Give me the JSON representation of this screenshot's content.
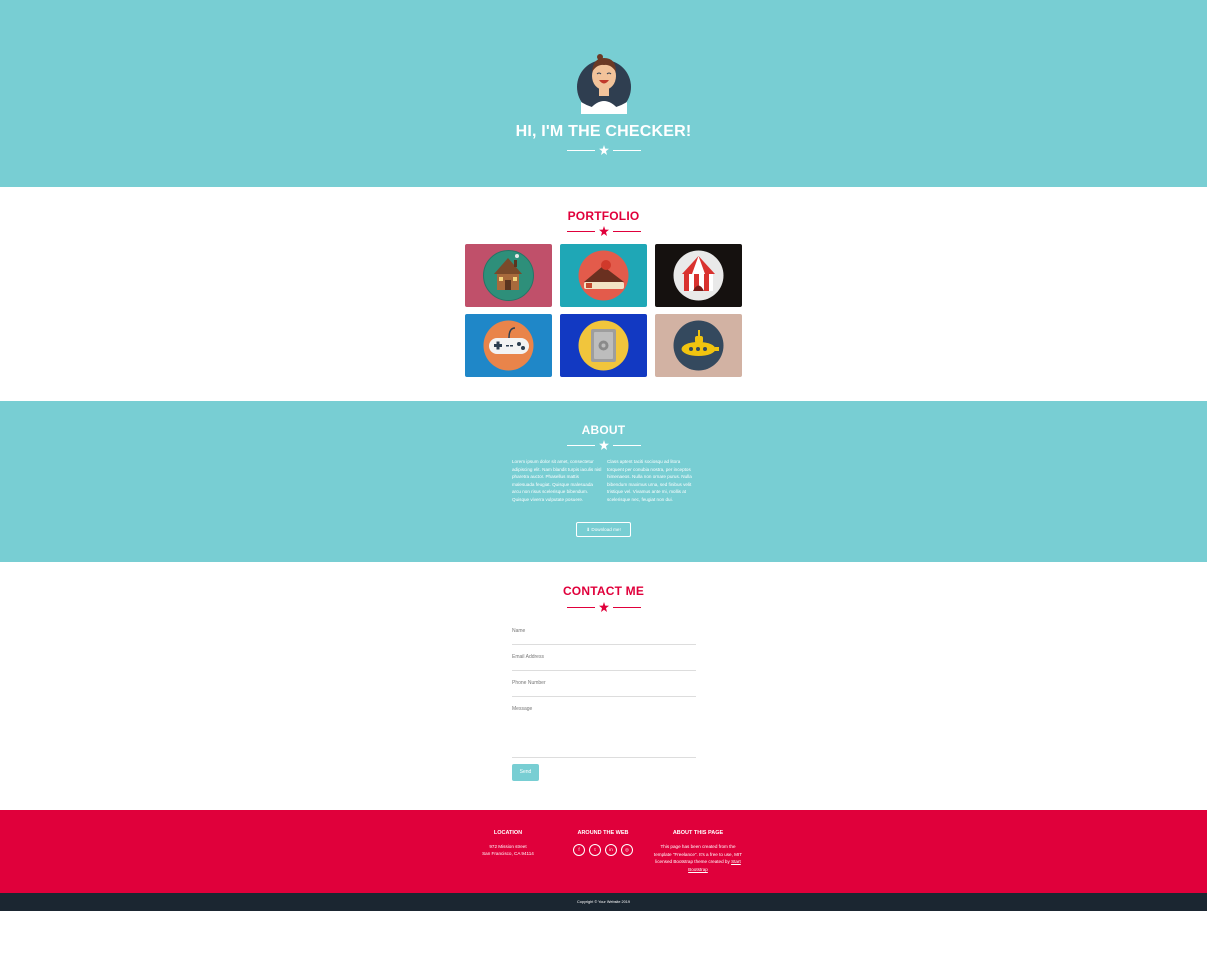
{
  "colors": {
    "teal": "#78ced3",
    "red": "#e0003b",
    "dark": "#1b2631",
    "white": "#ffffff"
  },
  "masthead": {
    "title": "HI, I'M THE CHECKER!",
    "avatar_icon": "avatar-icon"
  },
  "portfolio": {
    "title": "PORTFOLIO",
    "items": [
      {
        "icon": "cabin-icon",
        "bg": "#c0506a"
      },
      {
        "icon": "cake-icon",
        "bg": "#1fa7b6"
      },
      {
        "icon": "circus-tent-icon",
        "bg": "#15110f"
      },
      {
        "icon": "game-controller-icon",
        "bg": "#1f87c8"
      },
      {
        "icon": "safe-icon",
        "bg": "#1239c2"
      },
      {
        "icon": "submarine-icon",
        "bg": "#d2b2a3"
      }
    ]
  },
  "about": {
    "title": "ABOUT",
    "col1": "Lorem ipsum dolor sit amet, consectetur adipiscing elit. Nam blandit turpis iaculis nisl pharetra auctor. Phasellus mattis malesuada feugiat. Quisque malesuada arcu non risus scelerisque bibendum. Quisque viverra vulputate posuere.",
    "col2": "Class aptent taciti sociosqu ad litora torquent per conubia nostra, per inceptos himenaeos. Nulla non ornare purus. Nulla bibendum maximus urna, sed finibus velit tristique vel. Vivamus ante mi, mollis at scelerisque nec, feugiat non dui.",
    "download_label": "Download me!",
    "download_icon": "download-icon"
  },
  "contact": {
    "title": "CONTACT ME",
    "fields": {
      "name": "Name",
      "email": "Email Address",
      "phone": "Phone Number",
      "message": "Message"
    },
    "send_label": "Send"
  },
  "footer": {
    "location": {
      "heading": "LOCATION",
      "line1": "972 Mission street",
      "line2": "San Francisco, CA 94114"
    },
    "web": {
      "heading": "AROUND THE WEB",
      "icons": [
        "facebook-icon",
        "twitter-icon",
        "linkedin-icon",
        "dribbble-icon"
      ],
      "glyphs": [
        "f",
        "t",
        "in",
        "◎"
      ]
    },
    "about_page": {
      "heading": "ABOUT THIS PAGE",
      "text": "This page has been created from the template \"Freelance\". It's a free to use, MIT licensed Bootstrap theme created by",
      "link": "Start Bootstrap"
    },
    "copyright": "Copyright © Your Website 2019"
  }
}
